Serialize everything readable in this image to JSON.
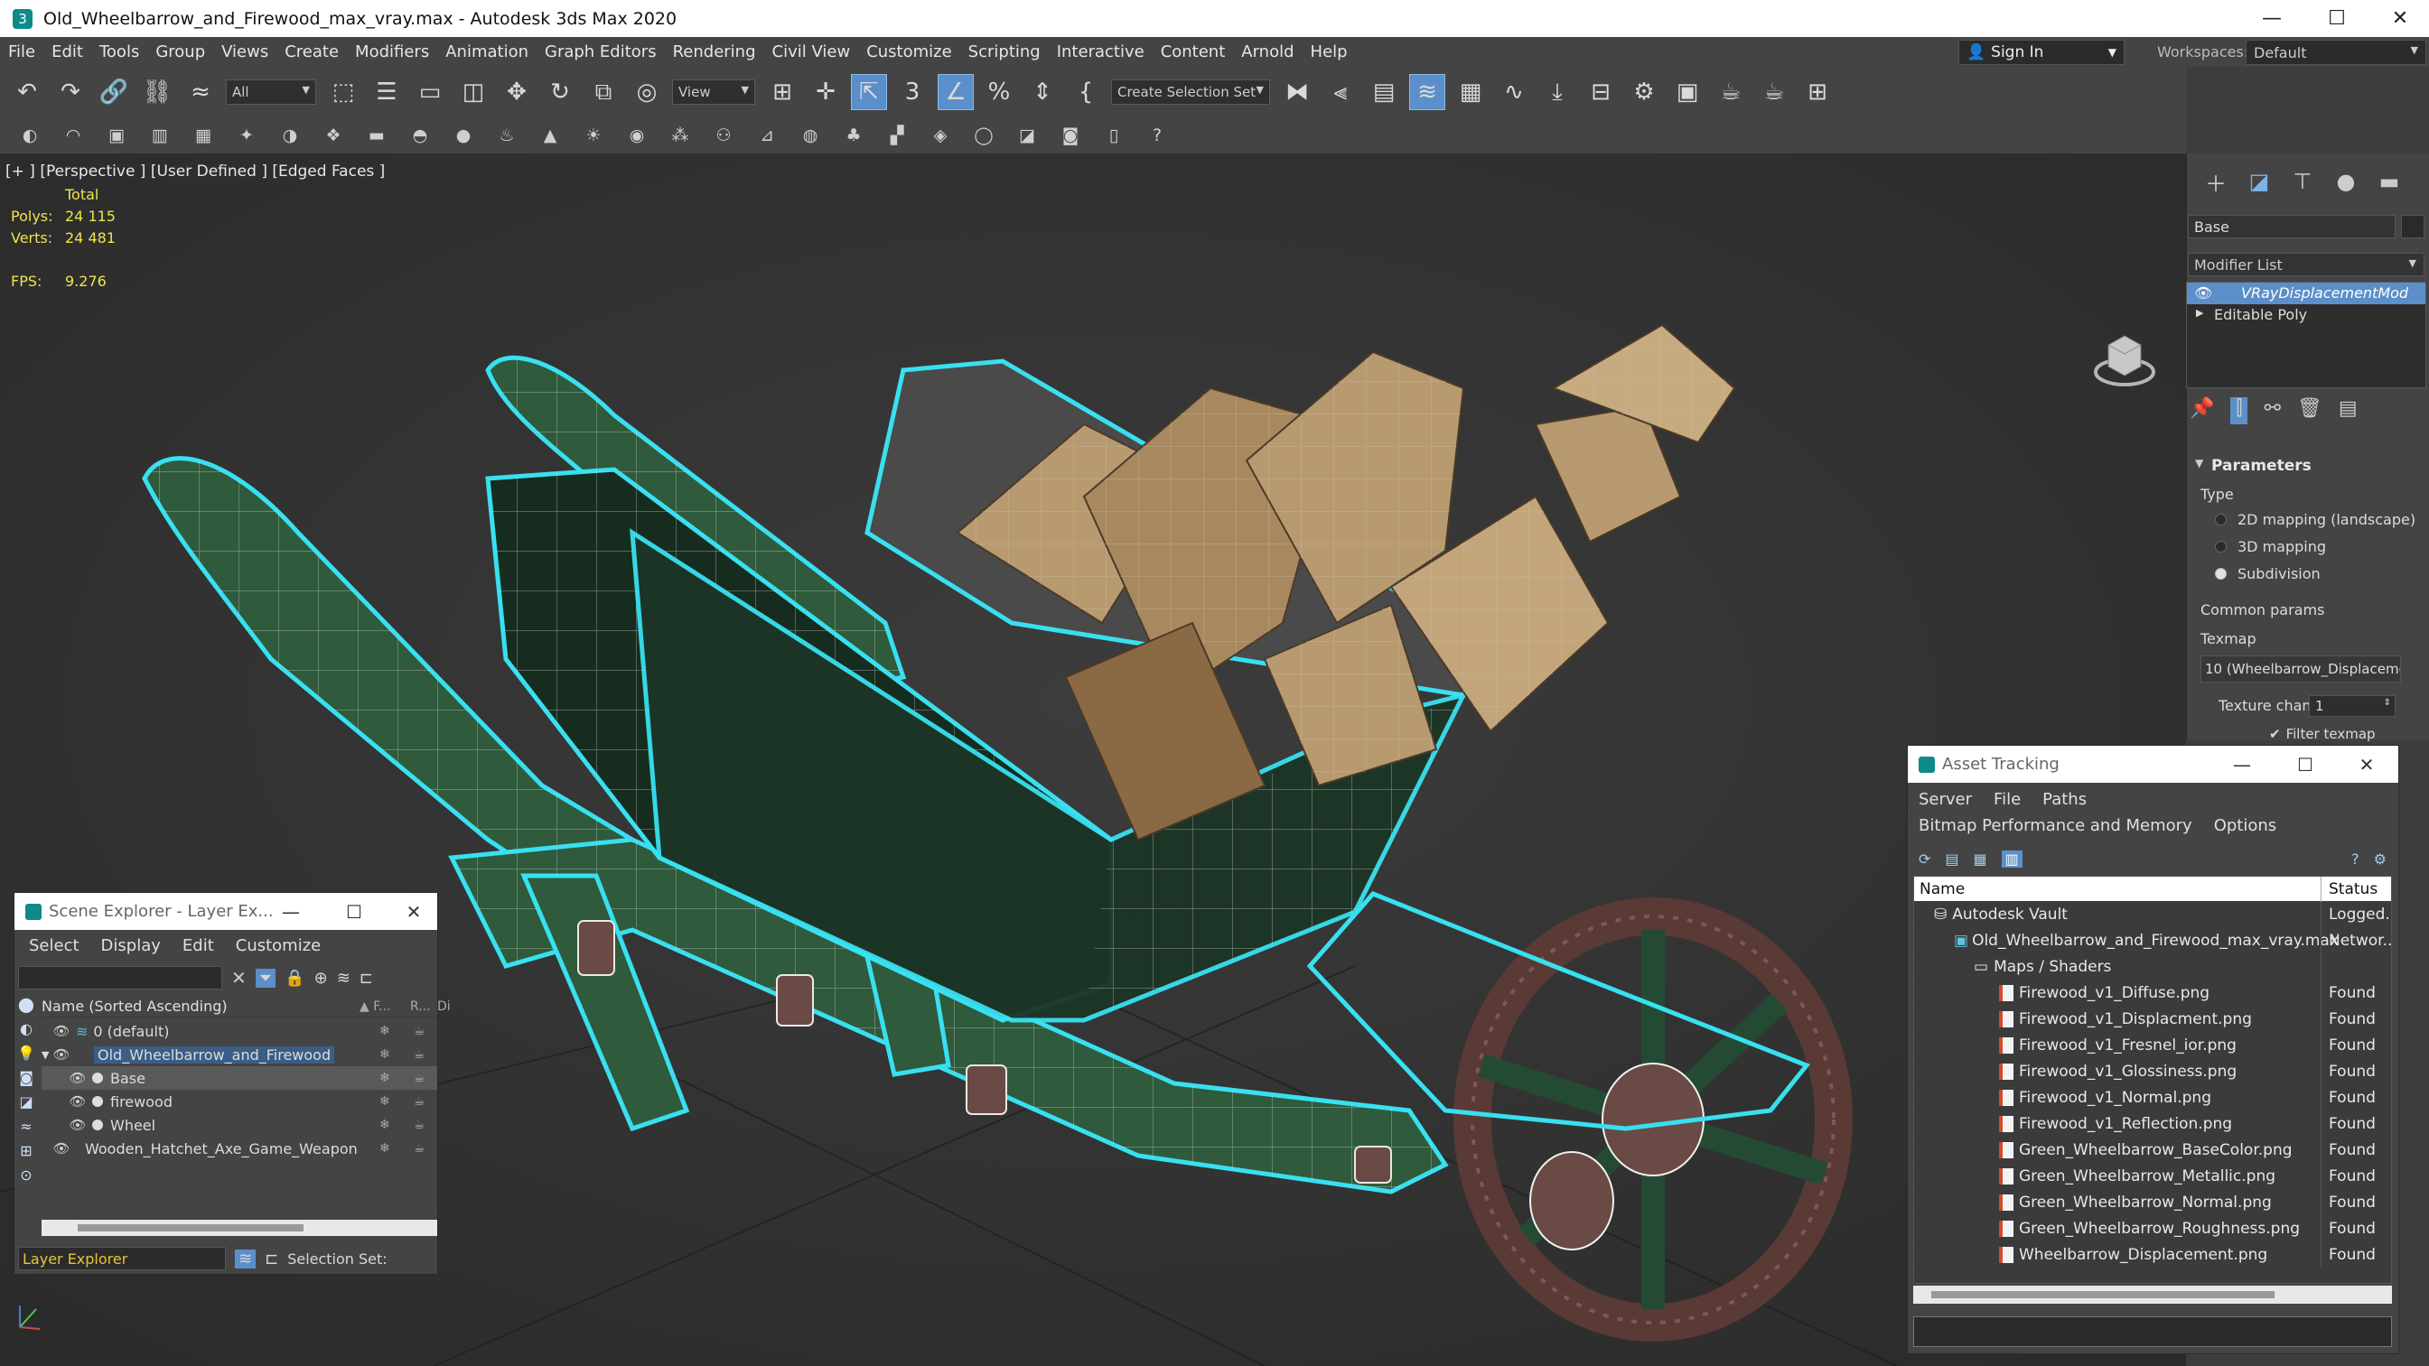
{
  "window": {
    "title": "Old_Wheelbarrow_and_Firewood_max_vray.max - Autodesk 3ds Max 2020"
  },
  "menu": [
    "File",
    "Edit",
    "Tools",
    "Group",
    "Views",
    "Create",
    "Modifiers",
    "Animation",
    "Graph Editors",
    "Rendering",
    "Civil View",
    "Customize",
    "Scripting",
    "Interactive",
    "Content",
    "Arnold",
    "Help"
  ],
  "account": {
    "sign_in": "Sign In",
    "workspaces_label": "Workspaces:",
    "workspace": "Default"
  },
  "toolbar": {
    "filter": "All",
    "ref_coord": "View",
    "selection_set": "Create Selection Set"
  },
  "viewport": {
    "label": "[+ ] [Perspective ] [User Defined ] [Edged Faces ]",
    "stats": {
      "total_label": "Total",
      "polys_label": "Polys:",
      "polys": "24 115",
      "verts_label": "Verts:",
      "verts": "24 481",
      "fps_label": "FPS:",
      "fps": "9.276"
    }
  },
  "command_panel": {
    "object_name": "Base",
    "modifier_list": "Modifier List",
    "stack": [
      "VRayDisplacementMod",
      "Editable Poly"
    ],
    "parameters": "Parameters",
    "type_label": "Type",
    "types": [
      "2D mapping (landscape)",
      "3D mapping",
      "Subdivision"
    ],
    "common_params": "Common params",
    "texmap_label": "Texmap",
    "texmap_value": "10 (Wheelbarrow_Displacemer",
    "texture_chan_label": "Texture chan",
    "texture_chan_value": "1",
    "filter_texmap": "Filter texmap"
  },
  "scene_explorer": {
    "title": "Scene Explorer - Layer Ex...",
    "menu": [
      "Select",
      "Display",
      "Edit",
      "Customize"
    ],
    "col_name": "Name (Sorted Ascending)",
    "col_f": "▲ F...",
    "col_r": "R...",
    "col_d": "Di",
    "rows": [
      {
        "name": "0 (default)"
      },
      {
        "name": "Old_Wheelbarrow_and_Firewood"
      },
      {
        "name": "Base"
      },
      {
        "name": "firewood"
      },
      {
        "name": "Wheel"
      },
      {
        "name": "Wooden_Hatchet_Axe_Game_Weapon"
      }
    ],
    "footer_mode": "Layer Explorer",
    "selection_set": "Selection Set:"
  },
  "asset_tracking": {
    "title": "Asset Tracking",
    "menu": [
      "Server",
      "File",
      "Paths",
      "Bitmap Performance and Memory",
      "Options"
    ],
    "col_name": "Name",
    "col_status": "Status",
    "rows": [
      {
        "name": "Autodesk Vault",
        "status": "Logged..."
      },
      {
        "name": "Old_Wheelbarrow_and_Firewood_max_vray.max",
        "status": "Networ..."
      },
      {
        "name": "Maps / Shaders",
        "status": ""
      },
      {
        "name": "Firewood_v1_Diffuse.png",
        "status": "Found"
      },
      {
        "name": "Firewood_v1_Displacment.png",
        "status": "Found"
      },
      {
        "name": "Firewood_v1_Fresnel_ior.png",
        "status": "Found"
      },
      {
        "name": "Firewood_v1_Glossiness.png",
        "status": "Found"
      },
      {
        "name": "Firewood_v1_Normal.png",
        "status": "Found"
      },
      {
        "name": "Firewood_v1_Reflection.png",
        "status": "Found"
      },
      {
        "name": "Green_Wheelbarrow_BaseColor.png",
        "status": "Found"
      },
      {
        "name": "Green_Wheelbarrow_Metallic.png",
        "status": "Found"
      },
      {
        "name": "Green_Wheelbarrow_Normal.png",
        "status": "Found"
      },
      {
        "name": "Green_Wheelbarrow_Roughness.png",
        "status": "Found"
      },
      {
        "name": "Wheelbarrow_Displacement.png",
        "status": "Found"
      }
    ]
  },
  "colors": {
    "accent": "#5b8fc9",
    "selection_outline": "#38e0f0",
    "stats": "#f0e44a",
    "wood": "#b89a70",
    "green_wood": "#2f5a3c"
  }
}
